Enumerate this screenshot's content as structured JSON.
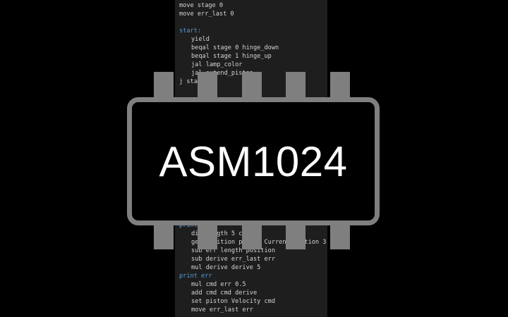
{
  "code_lines": [
    "move stage 0",
    "move err_last 0",
    "",
    "start:",
    "yield",
    "beqal stage 0 hinge_down",
    "beqal stage 1 hinge_up",
    "jal lamp_color",
    "jal extend_piston",
    "j start",
    "print err",
    "div length 5 count",
    "get position piston CurrentPosition 3",
    "sub err length position",
    "sub derive err_last err",
    "mul derive derive 5",
    "print err",
    "mul cmd err 0.5",
    "add cmd cmd derive",
    "set piston Velocity cmd",
    "move err_last err"
  ],
  "chip": {
    "title": "ASM1024",
    "colors": {
      "body_fill": "#000000",
      "outline": "#7f7f7f",
      "title_text": "#ffffff"
    }
  },
  "editor": {
    "colors": {
      "background": "#1e1e1e",
      "text": "#d4d4d4",
      "label": "#569cd6"
    }
  }
}
